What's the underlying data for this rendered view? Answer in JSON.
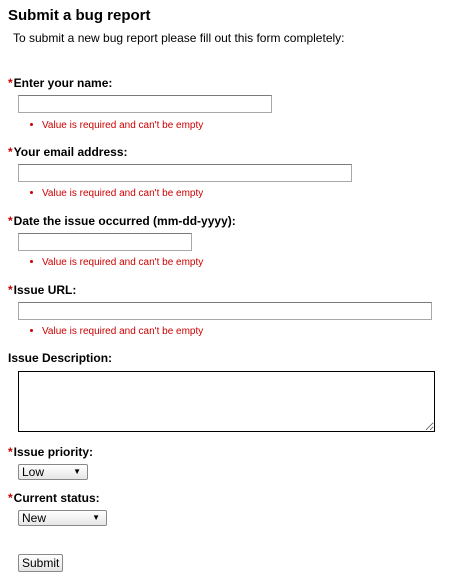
{
  "form": {
    "title": "Submit a bug report",
    "intro": "To submit a new bug report please fill out this form completely:",
    "required_marker": "*",
    "fields": {
      "name": {
        "label": "Enter your name:",
        "value": "",
        "error": "Value is required and can't be empty"
      },
      "email": {
        "label": "Your email address:",
        "value": "",
        "error": "Value is required and can't be empty"
      },
      "date": {
        "label": "Date the issue occurred (mm-dd-yyyy):",
        "value": "",
        "error": "Value is required and can't be empty"
      },
      "url": {
        "label": "Issue URL:",
        "value": "",
        "error": "Value is required and can't be empty"
      },
      "description": {
        "label": "Issue Description:",
        "value": ""
      },
      "priority": {
        "label": "Issue priority:",
        "selected": "Low",
        "arrow_icon": "triangle-down"
      },
      "status": {
        "label": "Current status:",
        "selected": "New",
        "arrow_icon": "triangle-down"
      }
    },
    "submit_label": "Submit",
    "colors": {
      "required": "#cc0000",
      "error_text": "#cc0000"
    }
  }
}
